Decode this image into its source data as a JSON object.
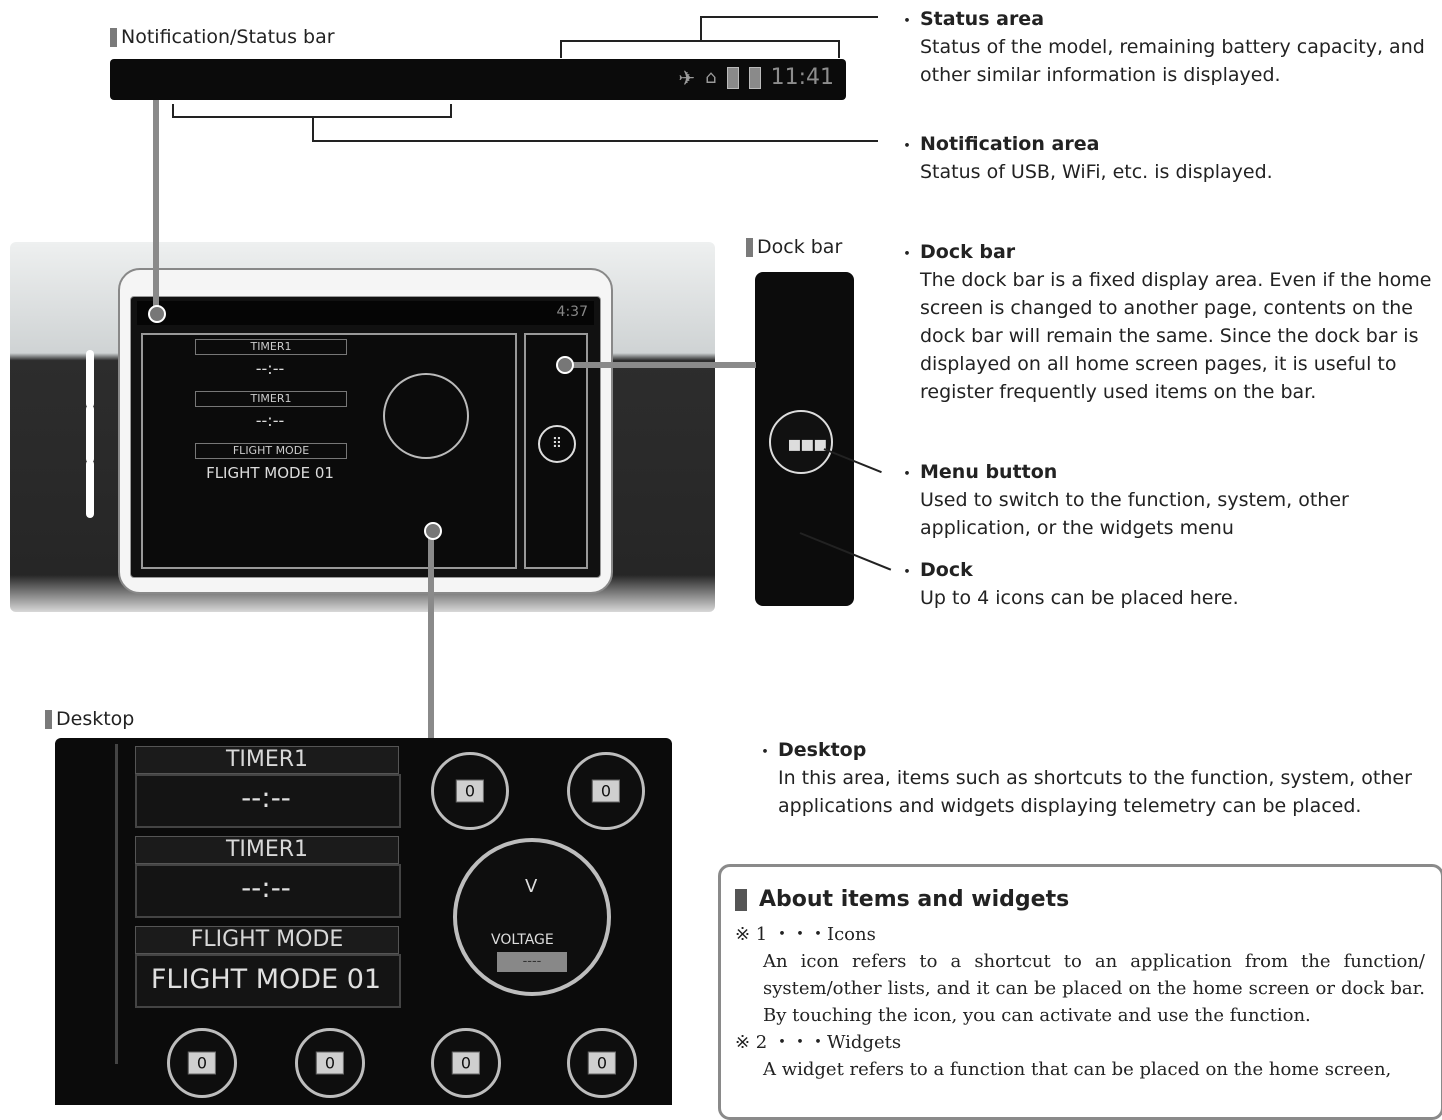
{
  "labels": {
    "notification_status_bar": "Notification/Status bar",
    "dock_bar": "Dock bar",
    "desktop": "Desktop"
  },
  "status_bar": {
    "time": "11:41"
  },
  "device_status_time": "4:37",
  "descriptions": {
    "status_area": {
      "title": "Status area",
      "text": "Status of the model, remaining battery capacity, and other similar information is displayed."
    },
    "notification_area": {
      "title": "Notification area",
      "text": "Status of USB, WiFi, etc. is displayed."
    },
    "dock_bar": {
      "title": "Dock bar",
      "text": "The dock bar is a fixed display area. Even if the home screen is changed to another page, contents on the dock bar will remain the same. Since the dock bar is displayed on all home screen pages, it is useful to register frequently used items on the bar."
    },
    "menu_button": {
      "title": "Menu button",
      "text": "Used to switch to the function, system, other application, or the widgets menu"
    },
    "dock": {
      "title": "Dock",
      "text": "Up to 4 icons can be placed here."
    },
    "desktop": {
      "title": "Desktop",
      "text": "In this area, items such as shortcuts to the function, system, other applications and widgets displaying telemetry can be placed."
    }
  },
  "widgets": {
    "timer1_label": "TIMER1",
    "timer2_label": "TIMER1",
    "timer_value": "--:--",
    "flight_mode_label": "FLIGHT MODE",
    "flight_mode_value": "FLIGHT MODE 01",
    "voltage_label": "VOLTAGE",
    "voltage_value": "----",
    "voltage_unit": "V",
    "trim_value": "0",
    "plus": "+",
    "minus": "−"
  },
  "info": {
    "title": "About items and widgets",
    "item1_head": "※ 1 ・・・Icons",
    "item1_text": "An icon refers to a shortcut to an application from the function/ system/other lists, and it can be placed on the home screen or dock bar. By touching the icon, you can activate and use the function.",
    "item2_head": "※ 2 ・・・Widgets",
    "item2_text": "A widget refers to a function that can be placed on the home screen,"
  },
  "bullet": "・"
}
